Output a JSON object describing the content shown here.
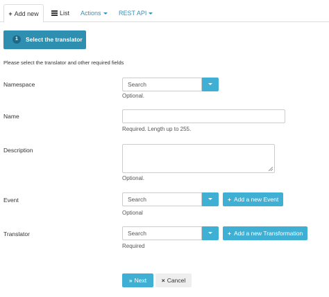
{
  "tabs": {
    "add_new": "Add new",
    "list": "List",
    "actions": "Actions",
    "rest_api": "REST API"
  },
  "step": {
    "number": "1",
    "label": "Select the translator"
  },
  "intro": "Please select the translator and other required fields",
  "fields": {
    "namespace": {
      "label": "Namespace",
      "placeholder": "Search",
      "hint": "Optional."
    },
    "name": {
      "label": "Name",
      "value": "",
      "hint": "Required. Length up to 255."
    },
    "description": {
      "label": "Description",
      "value": "",
      "hint": "Optional."
    },
    "event": {
      "label": "Event",
      "placeholder": "Search",
      "hint": "Optional",
      "add_button": "Add a new Event"
    },
    "translator": {
      "label": "Translator",
      "placeholder": "Search",
      "hint": "Required",
      "add_button": "Add a new Transformation"
    }
  },
  "buttons": {
    "next": "Next",
    "cancel": "Cancel"
  },
  "colors": {
    "primary": "#2e8fb0",
    "info": "#3fb0d4",
    "link": "#3a8fb7"
  },
  "icons": [
    "plus-icon",
    "list-icon",
    "caret-down-icon",
    "forward-icon",
    "close-icon",
    "resize-grip-icon"
  ]
}
